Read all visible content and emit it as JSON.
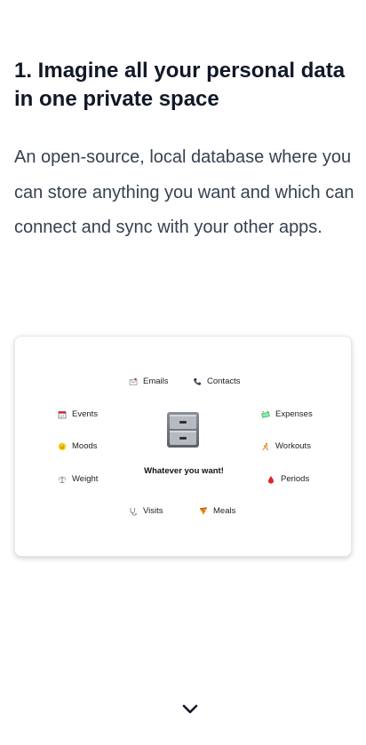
{
  "section": {
    "heading": "1. Imagine all your personal data in one private space",
    "description": "An open-source, local database where you can store anything you want and which can connect and sync with your other apps."
  },
  "illustration": {
    "center_label": "Whatever you want!",
    "center_icon": "file-cabinet-icon",
    "items": [
      {
        "label": "Emails",
        "icon": "envelope-icon"
      },
      {
        "label": "Contacts",
        "icon": "phone-icon"
      },
      {
        "label": "Events",
        "icon": "calendar-icon"
      },
      {
        "label": "Expenses",
        "icon": "money-icon"
      },
      {
        "label": "Moods",
        "icon": "smiley-icon"
      },
      {
        "label": "Workouts",
        "icon": "running-icon"
      },
      {
        "label": "Weight",
        "icon": "scale-icon"
      },
      {
        "label": "Periods",
        "icon": "drop-icon"
      },
      {
        "label": "Visits",
        "icon": "stethoscope-icon"
      },
      {
        "label": "Meals",
        "icon": "pizza-icon"
      }
    ]
  },
  "scroll_indicator": {
    "icon": "chevron-down-icon"
  }
}
